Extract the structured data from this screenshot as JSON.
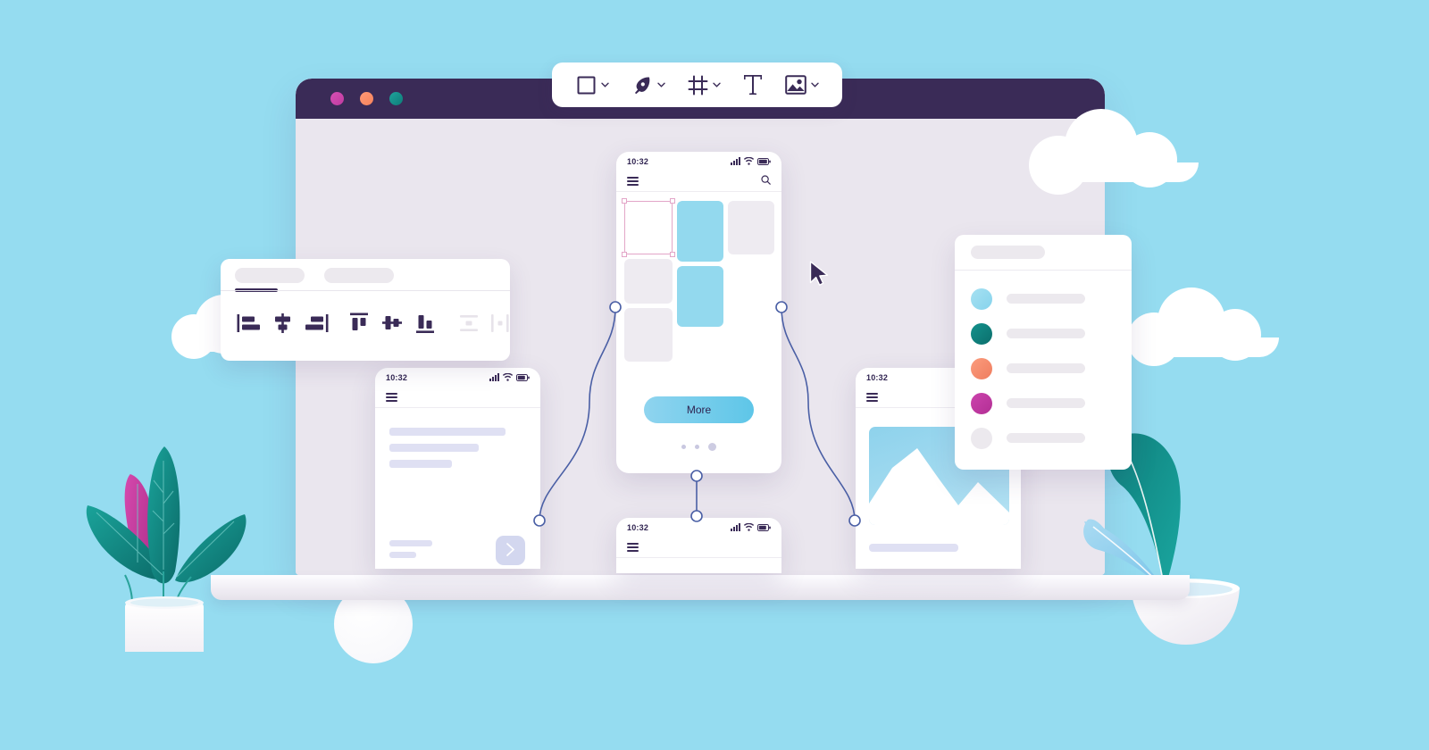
{
  "meta": {
    "title": "UI design tool illustration",
    "background_color": "#95dcf0"
  },
  "toolbar": {
    "name": "design-tools-toolbar",
    "items": [
      {
        "id": "shape",
        "icon": "square-icon",
        "label": "Shape",
        "has_dropdown": true
      },
      {
        "id": "pen",
        "icon": "pen-nib-icon",
        "label": "Pen",
        "has_dropdown": true
      },
      {
        "id": "frame",
        "icon": "frame-icon",
        "label": "Frame",
        "has_dropdown": true
      },
      {
        "id": "text",
        "icon": "text-t-icon",
        "label": "T",
        "has_dropdown": false
      },
      {
        "id": "image",
        "icon": "image-icon",
        "label": "Image",
        "has_dropdown": true
      }
    ]
  },
  "browser": {
    "title_bar_color": "#3a2b57",
    "traffic_lights": [
      {
        "name": "close-dot",
        "color": "#d650b4"
      },
      {
        "name": "minimize-dot",
        "color": "#ff9a76"
      },
      {
        "name": "maximize-dot",
        "color": "#1fa39b"
      }
    ]
  },
  "align_panel": {
    "tabs": [
      {
        "id": "tab-1",
        "label": "",
        "active": true
      },
      {
        "id": "tab-2",
        "label": "",
        "active": false
      }
    ],
    "active_indicator_color": "#3a2b57",
    "icons": [
      {
        "id": "align-left",
        "name": "align-left-icon",
        "enabled": true
      },
      {
        "id": "align-center-horizontal",
        "name": "align-center-horizontal-icon",
        "enabled": true
      },
      {
        "id": "align-right",
        "name": "align-right-icon",
        "enabled": true
      },
      {
        "id": "align-top",
        "name": "align-top-icon",
        "enabled": true
      },
      {
        "id": "align-center-vertical",
        "name": "align-center-vertical-icon",
        "enabled": true
      },
      {
        "id": "align-bottom",
        "name": "align-bottom-icon",
        "enabled": true
      },
      {
        "id": "distribute-vertical",
        "name": "distribute-vertical-icon",
        "enabled": false
      },
      {
        "id": "distribute-horizontal",
        "name": "distribute-horizontal-icon",
        "enabled": false
      }
    ]
  },
  "phone_center": {
    "name": "phone-mockup-center",
    "status_time": "10:32",
    "nav": {
      "menu_icon": "hamburger-menu-icon",
      "search_icon": "search-icon"
    },
    "selection": {
      "selected": true,
      "handle_color": "#e3a6c8"
    },
    "tiles": [
      {
        "id": "tile-1",
        "color": "selected"
      },
      {
        "id": "tile-2",
        "color": "#93d9ee"
      },
      {
        "id": "tile-3",
        "color": "#eeebf1"
      },
      {
        "id": "tile-4",
        "color": "#eeebf1"
      },
      {
        "id": "tile-5",
        "color": "#93d9ee"
      },
      {
        "id": "tile-6",
        "color": "#eeebf1"
      }
    ],
    "cta": {
      "label": "More",
      "gradient_from": "#8fd4ef",
      "gradient_to": "#5ec6e8"
    },
    "pagination": {
      "total": 3,
      "active_index": 2
    }
  },
  "phone_left": {
    "name": "phone-mockup-left",
    "status_time": "10:32",
    "nav": {
      "menu_icon": "hamburger-menu-icon"
    },
    "text_lines": [
      130,
      100,
      70
    ],
    "small_lines": [
      48,
      30
    ],
    "next_button": {
      "icon": "chevron-right-icon"
    }
  },
  "phone_right": {
    "name": "phone-mockup-right",
    "status_time": "10:32",
    "nav": {
      "menu_icon": "hamburger-menu-icon"
    },
    "image_placeholder": {
      "name": "mountain-landscape-image",
      "color": "#8ed2ec"
    }
  },
  "phone_bottom": {
    "name": "phone-mockup-bottom",
    "status_time": "10:32",
    "nav": {
      "menu_icon": "hamburger-menu-icon"
    }
  },
  "list_panel": {
    "name": "color-list-panel",
    "header_pill": true,
    "rows": [
      {
        "id": "row-1",
        "swatch": "#93d9ee",
        "swatch_name": "light-blue-swatch"
      },
      {
        "id": "row-2",
        "swatch": "#11807c",
        "swatch_name": "teal-swatch"
      },
      {
        "id": "row-3",
        "swatch": "#f58a6a",
        "swatch_name": "orange-swatch"
      },
      {
        "id": "row-4",
        "swatch": "#bf35a0",
        "swatch_name": "magenta-swatch"
      },
      {
        "id": "row-5",
        "swatch": "#ece9ee",
        "swatch_name": "empty-swatch"
      }
    ]
  },
  "connectors": {
    "name": "prototype-flow-links",
    "stroke": "#4a5fa5",
    "node_count": 6
  },
  "decorations": {
    "cursor": {
      "name": "mouse-pointer-cursor",
      "color": "#3a2b57"
    },
    "clouds": 3,
    "plants": [
      {
        "name": "potted-plant-left",
        "leaf_colors": [
          "#0f7a78",
          "#c2379f"
        ]
      },
      {
        "name": "potted-plant-right",
        "leaf_colors": [
          "#0f7a78",
          "#8ecdec"
        ]
      }
    ],
    "sphere": {
      "name": "white-sphere-decoration",
      "color": "#ffffff"
    }
  }
}
